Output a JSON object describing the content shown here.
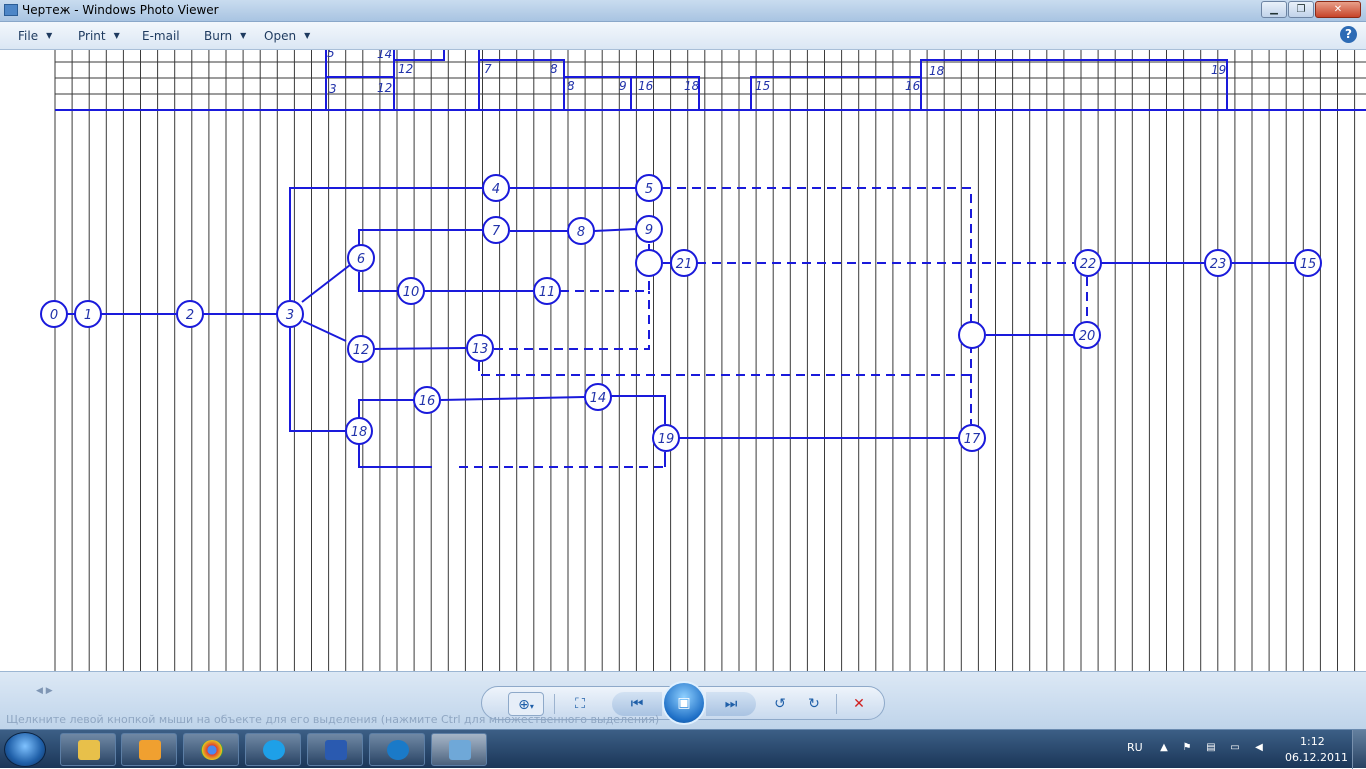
{
  "window": {
    "title": "Чертеж - Windows Photo Viewer"
  },
  "menu": [
    {
      "label": "File",
      "dropdown": true
    },
    {
      "label": "Print",
      "dropdown": true
    },
    {
      "label": "E-mail",
      "dropdown": false
    },
    {
      "label": "Burn",
      "dropdown": true
    },
    {
      "label": "Open",
      "dropdown": true
    }
  ],
  "help": {
    "label": "?"
  },
  "drawing": {
    "line_color": "#1a1adb",
    "table_labels": [
      "5",
      "14",
      "12",
      "3",
      "12",
      "7",
      "8",
      "8",
      "9",
      "16",
      "18",
      "15",
      "16",
      "18",
      "19"
    ],
    "nodes": [
      "0",
      "1",
      "2",
      "3",
      "4",
      "5",
      "6",
      "7",
      "8",
      "9",
      "",
      "21",
      "10",
      "11",
      "12",
      "13",
      "",
      "20",
      "22",
      "23",
      "15",
      "16",
      "14",
      "18",
      "19",
      "17"
    ]
  },
  "controls": {
    "zoom_icon": "magnifier-plus-icon",
    "fit_icon": "actual-size-icon",
    "prev_icon": "previous-icon",
    "slideshow_icon": "slideshow-icon",
    "next_icon": "next-icon",
    "rotate_left_icon": "rotate-ccw-icon",
    "rotate_right_icon": "rotate-cw-icon",
    "delete_icon": "delete-icon"
  },
  "status_text": "Щелкните левой кнопкой мыши на объекте для его выделения (нажмите Ctrl для множественного выделения)",
  "taskbar": {
    "apps": [
      "explorer",
      "media-player",
      "chrome",
      "skype",
      "word",
      "app-k",
      "photo-viewer"
    ],
    "language": "RU",
    "time": "1:12",
    "date": "06.12.2011"
  }
}
